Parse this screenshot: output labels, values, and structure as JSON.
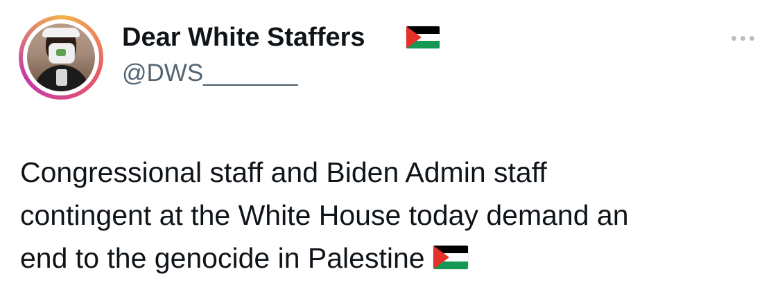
{
  "author": {
    "display_name": "Dear White Staffers",
    "handle": "@DWS_______",
    "name_emoji": "palestine-flag-icon",
    "avatar": "profile-photo"
  },
  "menu": {
    "icon": "more-options-icon"
  },
  "tweet": {
    "lines": [
      "Congressional staff and Biden Admin staff",
      "contingent at the White House today demand an",
      "end to the genocide in Palestine"
    ],
    "trailing_emoji": "palestine-flag-icon"
  },
  "colors": {
    "text_primary": "#0f1419",
    "text_secondary": "#536471",
    "flag_black": "#000000",
    "flag_white": "#ffffff",
    "flag_green": "#149954",
    "flag_red": "#e4312b"
  }
}
